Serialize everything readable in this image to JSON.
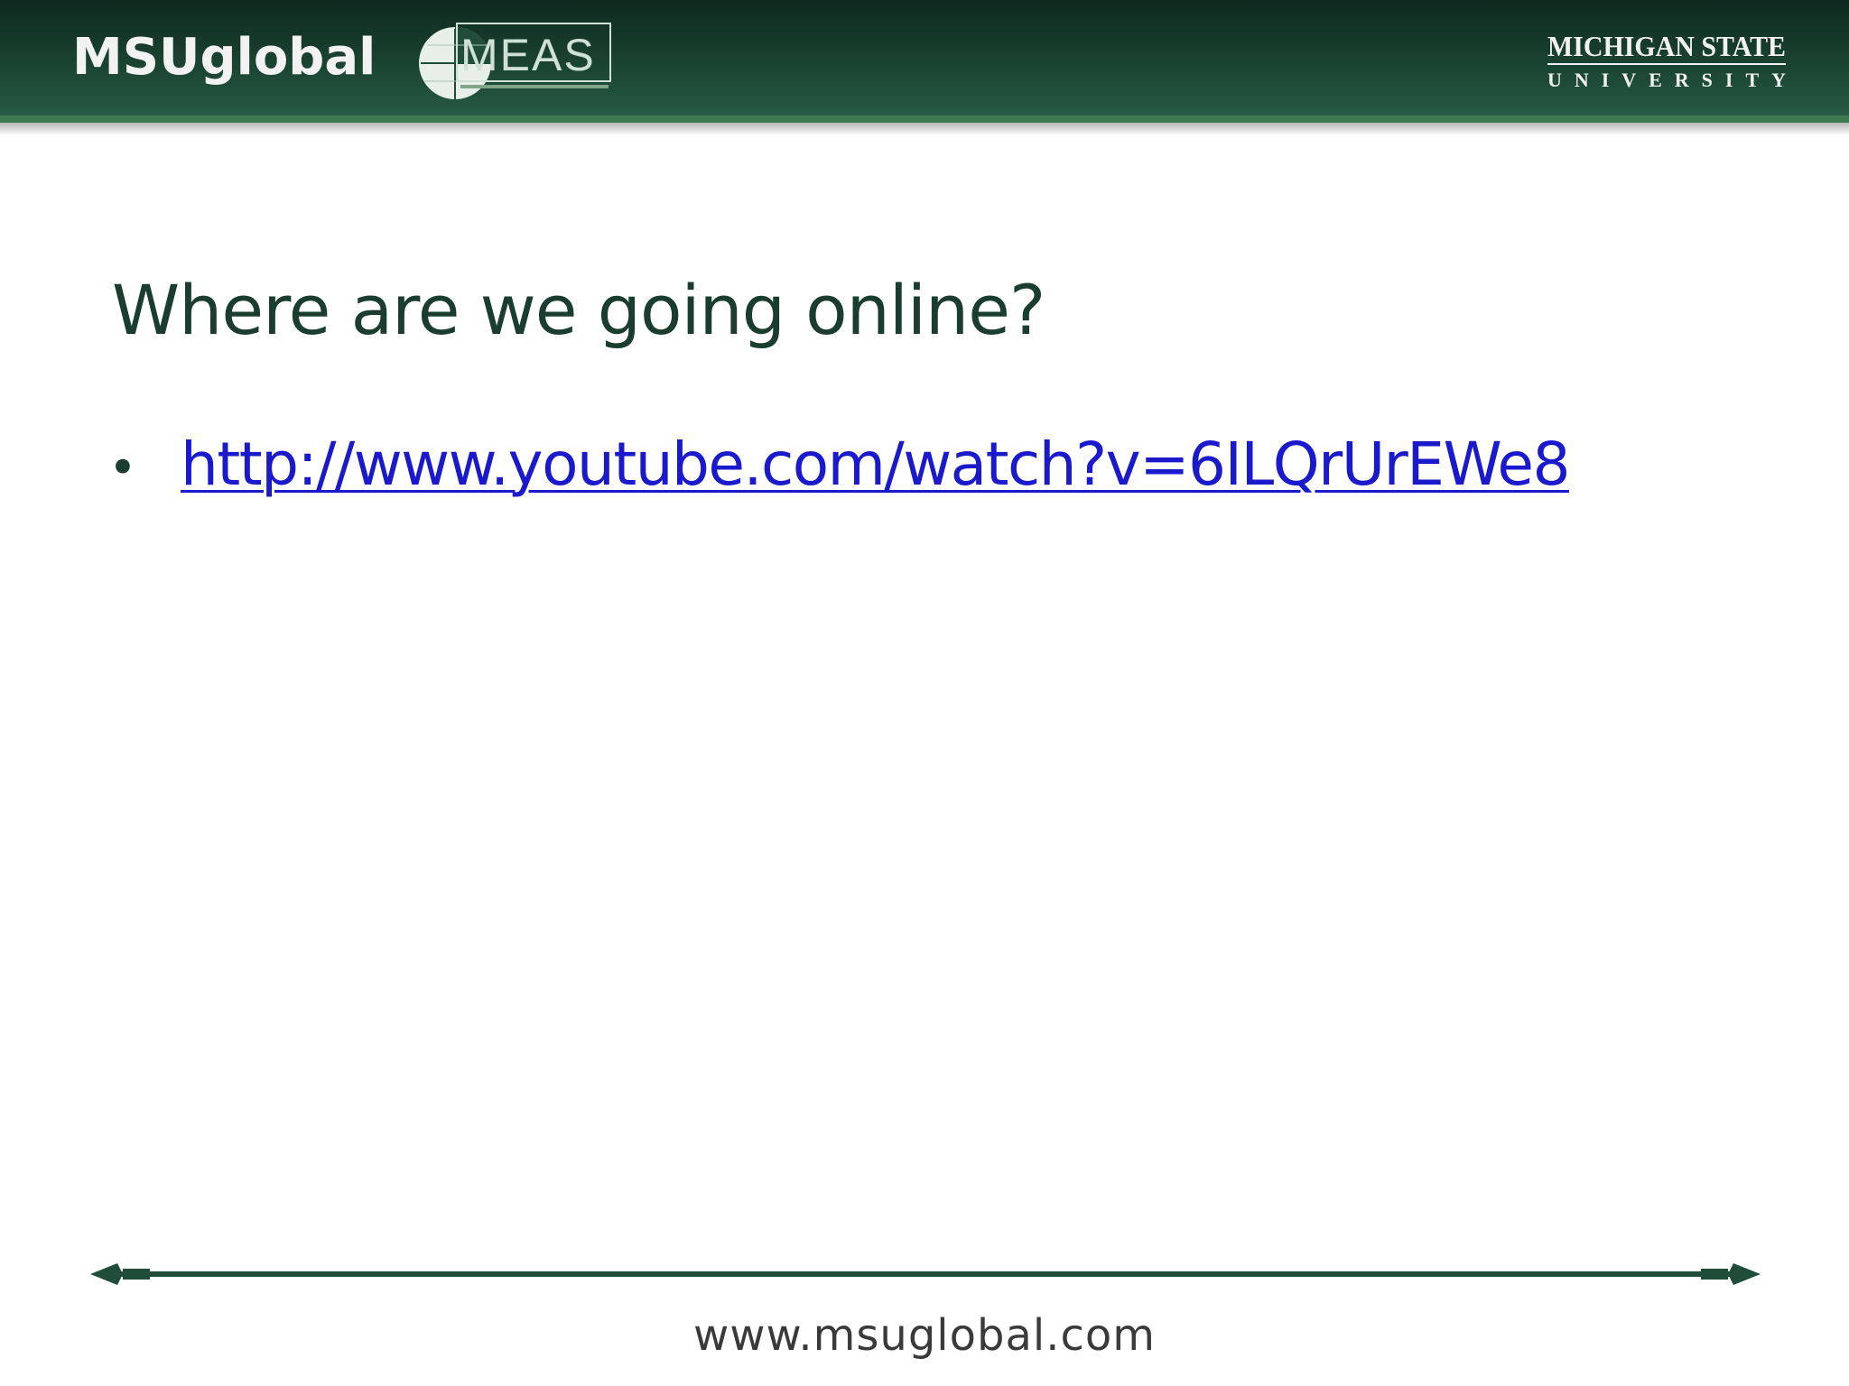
{
  "header": {
    "brand": "MSUglobal",
    "partner_logo_text": "MEAS",
    "university_name_line1": "MICHIGAN STATE",
    "university_name_line2": "UNIVERSITY"
  },
  "slide": {
    "title": "Where are we going online?",
    "bullets": [
      {
        "text": "http://www.youtube.com/watch?v=6ILQrUrEWe8"
      }
    ]
  },
  "footer": {
    "url": "www.msuglobal.com"
  },
  "colors": {
    "header_green": "#163a2b",
    "title_green": "#1a3d30",
    "link_blue": "#1a1acc"
  }
}
